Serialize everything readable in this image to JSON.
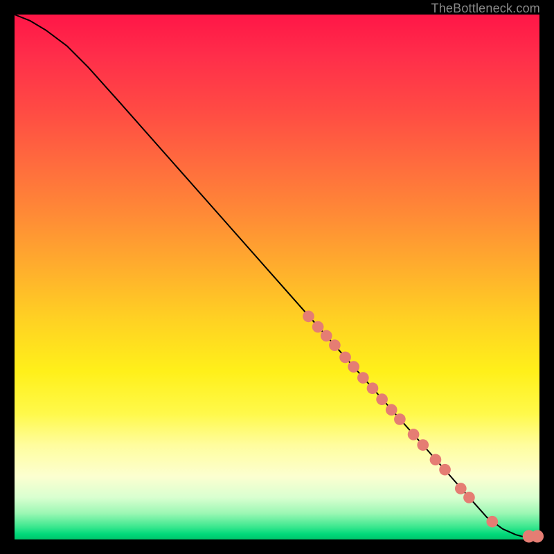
{
  "attribution": "TheBottleneck.com",
  "palette": {
    "background": "#000000",
    "curve_stroke": "#000000",
    "marker_fill": "#e57d73",
    "gradient_top": "#ff1647",
    "gradient_mid": "#ffe020",
    "gradient_bottom": "#00c46b"
  },
  "chart_data": {
    "type": "line",
    "title": "",
    "xlabel": "",
    "ylabel": "",
    "xlim": [
      0,
      100
    ],
    "ylim": [
      0,
      100
    ],
    "grid": false,
    "legend": false,
    "annotations": [],
    "curve": {
      "name": "bottleneck-curve",
      "x": [
        0,
        3,
        6,
        10,
        14,
        20,
        30,
        40,
        50,
        60,
        70,
        80,
        86,
        90,
        93,
        95.5,
        97,
        100
      ],
      "y": [
        100,
        98.8,
        97.0,
        94.0,
        90.0,
        83.3,
        72.0,
        60.7,
        49.4,
        38.1,
        26.8,
        15.5,
        8.7,
        4.2,
        2.0,
        0.9,
        0.5,
        0.5
      ]
    },
    "markers": {
      "name": "highlighted-points",
      "color": "#e57d73",
      "points": [
        {
          "x": 56.0,
          "y": 42.5,
          "r": 1.1
        },
        {
          "x": 57.8,
          "y": 40.5,
          "r": 1.1
        },
        {
          "x": 59.4,
          "y": 38.8,
          "r": 1.1
        },
        {
          "x": 61.0,
          "y": 37.0,
          "r": 1.1
        },
        {
          "x": 63.0,
          "y": 34.7,
          "r": 1.1
        },
        {
          "x": 64.6,
          "y": 32.9,
          "r": 1.1
        },
        {
          "x": 66.4,
          "y": 30.8,
          "r": 1.1
        },
        {
          "x": 68.2,
          "y": 28.8,
          "r": 1.1
        },
        {
          "x": 70.0,
          "y": 26.7,
          "r": 1.1
        },
        {
          "x": 71.8,
          "y": 24.7,
          "r": 1.1
        },
        {
          "x": 73.4,
          "y": 22.9,
          "r": 1.1
        },
        {
          "x": 76.0,
          "y": 20.0,
          "r": 1.1
        },
        {
          "x": 77.8,
          "y": 18.0,
          "r": 1.1
        },
        {
          "x": 80.2,
          "y": 15.2,
          "r": 1.1
        },
        {
          "x": 82.0,
          "y": 13.3,
          "r": 1.1
        },
        {
          "x": 85.0,
          "y": 9.7,
          "r": 1.1
        },
        {
          "x": 86.6,
          "y": 8.0,
          "r": 1.1
        },
        {
          "x": 91.0,
          "y": 3.4,
          "r": 1.1
        },
        {
          "x": 98.0,
          "y": 0.6,
          "r": 1.2
        },
        {
          "x": 99.6,
          "y": 0.6,
          "r": 1.2
        }
      ]
    }
  }
}
